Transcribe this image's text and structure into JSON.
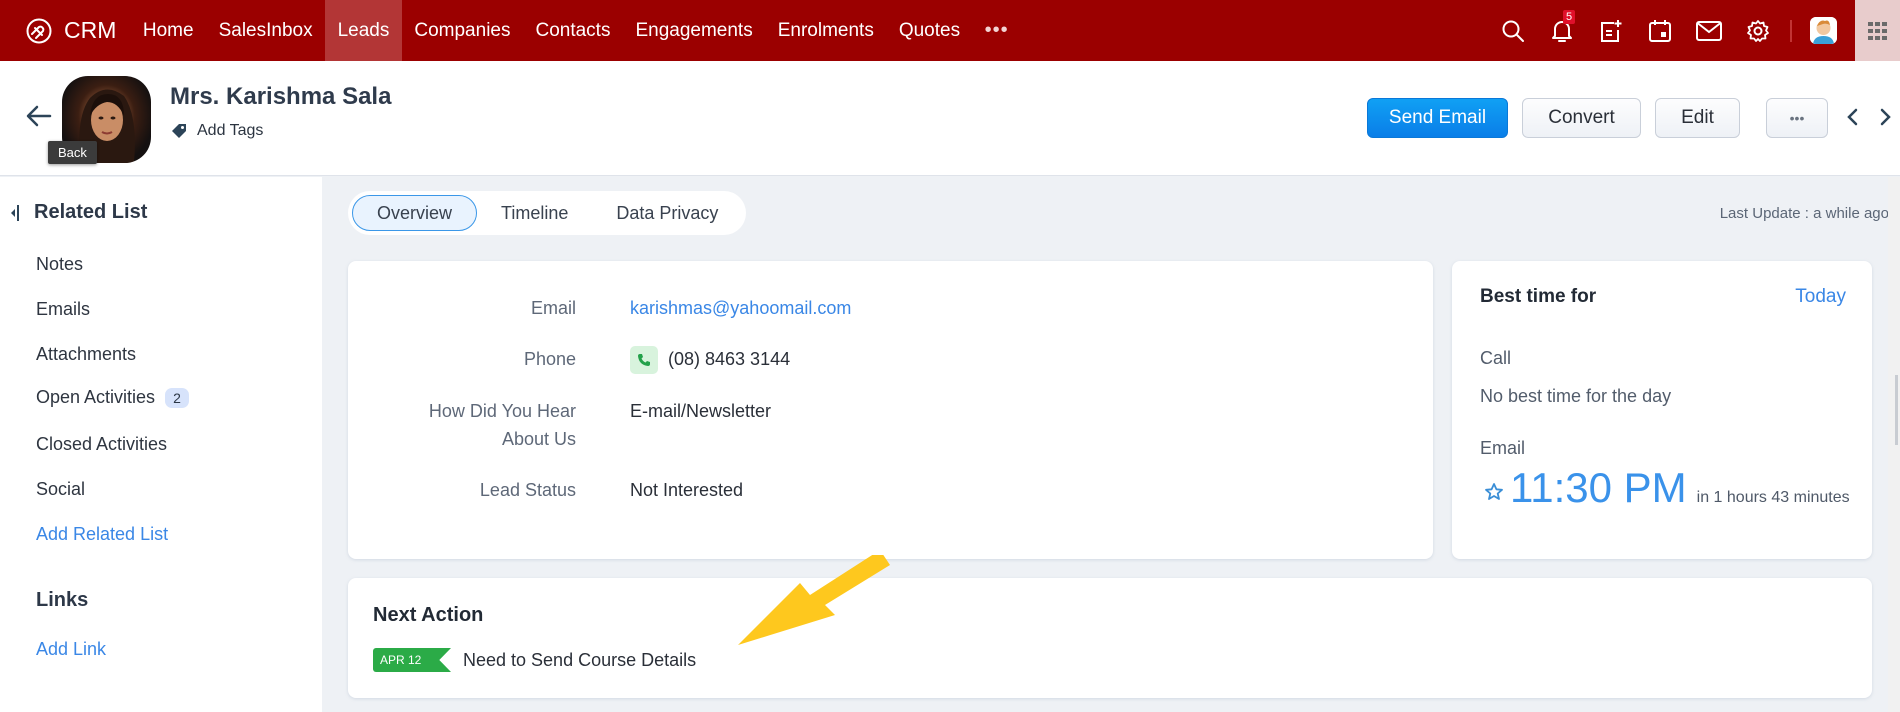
{
  "topbar": {
    "brand": "CRM",
    "nav": [
      "Home",
      "SalesInbox",
      "Leads",
      "Companies",
      "Contacts",
      "Engagements",
      "Enrolments",
      "Quotes"
    ],
    "active_nav": "Leads",
    "more_label": "•••",
    "notification_count": "5",
    "icons": [
      "search-icon",
      "bell-icon",
      "add-note-icon",
      "calendar-icon",
      "mail-icon",
      "gear-icon",
      "user-avatar",
      "apps-grid-icon"
    ],
    "brand_color": "#9b0000"
  },
  "header": {
    "back_tooltip": "Back",
    "lead_name": "Mrs. Karishma Sala",
    "add_tags": "Add Tags",
    "buttons": {
      "send_email": "Send Email",
      "convert": "Convert",
      "edit": "Edit",
      "more": "•••"
    }
  },
  "sidebar": {
    "related_list_title": "Related List",
    "items": [
      {
        "label": "Notes"
      },
      {
        "label": "Emails"
      },
      {
        "label": "Attachments"
      },
      {
        "label": "Open Activities",
        "count": "2"
      },
      {
        "label": "Closed Activities"
      },
      {
        "label": "Social"
      }
    ],
    "add_related_list": "Add Related List",
    "links_title": "Links",
    "add_link": "Add Link"
  },
  "tabs": [
    {
      "label": "Overview",
      "active": true
    },
    {
      "label": "Timeline",
      "active": false
    },
    {
      "label": "Data Privacy",
      "active": false
    }
  ],
  "last_update": "Last Update : a while ago",
  "details": {
    "fields": [
      {
        "label": "Email",
        "value": "karishmas@yahoomail.com"
      },
      {
        "label": "Phone",
        "value": "(08) 8463 3144"
      },
      {
        "label_line1": "How Did You Hear",
        "label_line2": "About Us",
        "value": "E-mail/Newsletter"
      },
      {
        "label": "Lead Status",
        "value": "Not Interested"
      }
    ]
  },
  "best_time": {
    "title": "Best time for",
    "period": "Today",
    "call_label": "Call",
    "call_value": "No best time for the day",
    "email_label": "Email",
    "email_time": "11:30 PM",
    "email_relative": "in 1 hours 43 minutes"
  },
  "next_action": {
    "title": "Next Action",
    "date": "APR 12",
    "text": "Need to Send Course Details"
  }
}
